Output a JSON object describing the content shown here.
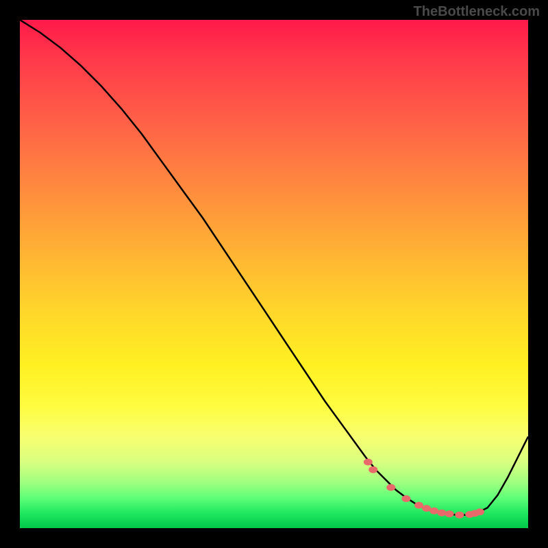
{
  "watermark": "TheBottleneck.com",
  "chart_data": {
    "type": "line",
    "title": "",
    "xlabel": "",
    "ylabel": "",
    "xlim": [
      0,
      100
    ],
    "ylim": [
      0,
      100
    ],
    "curve": {
      "x": [
        0,
        4,
        8,
        12,
        16,
        20,
        24,
        28,
        32,
        36,
        40,
        44,
        48,
        52,
        56,
        60,
        64,
        68,
        70,
        72,
        74,
        76,
        78,
        80,
        82,
        84,
        86,
        88,
        90,
        92,
        94,
        96,
        98,
        100
      ],
      "y": [
        100,
        97.5,
        94.5,
        91,
        87,
        82.5,
        77.5,
        72,
        66.5,
        61,
        55,
        49,
        43,
        37,
        31,
        25,
        19.5,
        14,
        11.5,
        9.5,
        7.5,
        6,
        4.7,
        3.8,
        3.2,
        2.8,
        2.6,
        2.6,
        3.0,
        4.0,
        6.5,
        10,
        14,
        18
      ]
    },
    "markers": {
      "x": [
        68.5,
        69.5,
        73,
        76,
        78.5,
        80,
        81.5,
        83,
        84.5,
        86.5,
        88.5,
        89.5,
        90.5
      ],
      "y": [
        13.0,
        11.5,
        8.0,
        5.8,
        4.5,
        3.9,
        3.4,
        3.0,
        2.8,
        2.6,
        2.7,
        2.9,
        3.2
      ]
    },
    "marker_color": "#e86a6a",
    "curve_color": "#000000",
    "gradient": [
      {
        "stop": 0.0,
        "color": "#ff1a4a"
      },
      {
        "stop": 0.5,
        "color": "#ffd028"
      },
      {
        "stop": 0.82,
        "color": "#f8ff70"
      },
      {
        "stop": 1.0,
        "color": "#00c84a"
      }
    ]
  }
}
